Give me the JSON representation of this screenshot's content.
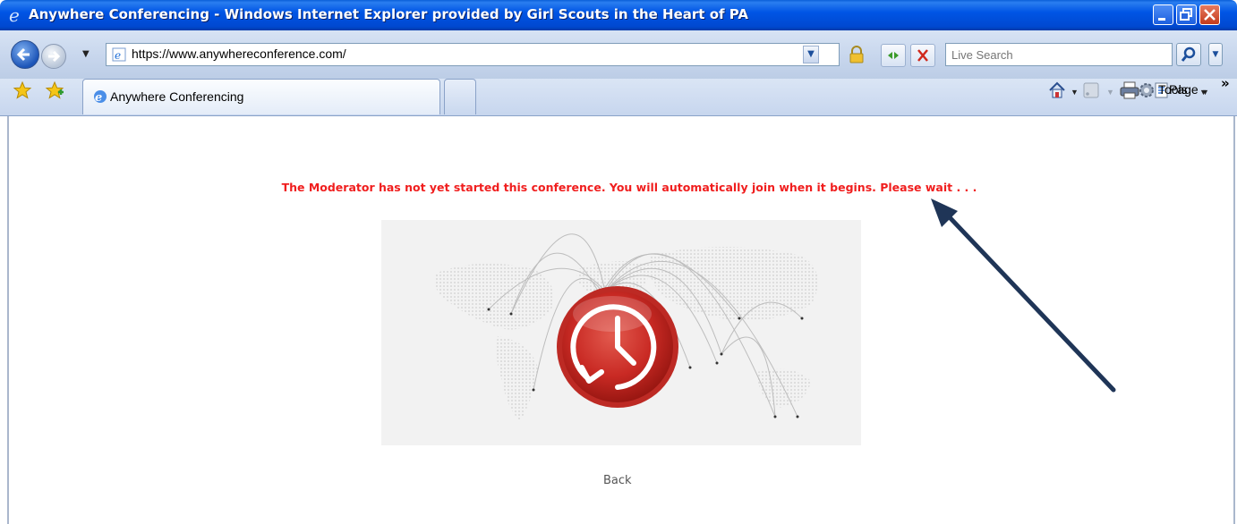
{
  "window": {
    "title": "Anywhere Conferencing - Windows Internet Explorer provided by Girl Scouts in the Heart of PA"
  },
  "address_bar": {
    "url": "https://www.anywhereconference.com/",
    "search_placeholder": "Live Search"
  },
  "tabs": [
    {
      "label": "Anywhere Conferencing"
    }
  ],
  "command_bar": {
    "page_label": "Page",
    "tools_label": "Tools"
  },
  "content": {
    "message": "The Moderator has not yet started this conference. You will automatically join when it begins. Please wait . . .",
    "back_link": "Back"
  },
  "colors": {
    "message_red": "#f01e1e",
    "titlebar_blue": "#0055e5",
    "annotation_arrow": "#1f3557",
    "clock_red": "#c92a24"
  },
  "icons": [
    "ie-logo-icon",
    "minimize-icon",
    "maximize-icon",
    "close-icon",
    "back-arrow-icon",
    "forward-arrow-icon",
    "lock-icon",
    "refresh-icon",
    "stop-icon",
    "search-icon",
    "favorites-star-icon",
    "add-favorites-icon",
    "home-icon",
    "feeds-icon",
    "print-icon",
    "page-icon",
    "tools-gear-icon",
    "clock-icon"
  ]
}
